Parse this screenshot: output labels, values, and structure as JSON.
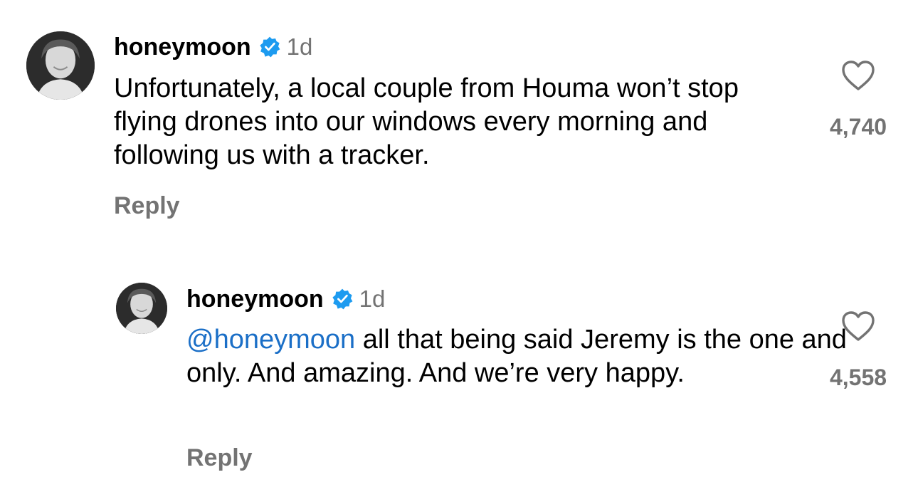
{
  "comments": [
    {
      "username": "honeymoon",
      "verified": true,
      "time": "1d",
      "text_mention": "",
      "text": "Unfortunately, a local couple from Houma won’t stop flying drones into our windows every morning and following us with a tracker.",
      "reply_label": "Reply",
      "like_count": "4,740",
      "avatar_icon": "profile-photo"
    },
    {
      "username": "honeymoon",
      "verified": true,
      "time": "1d",
      "text_mention": "@honeymoon",
      "text": "all that being said Jeremy is the one and only. And amazing. And we’re very happy.",
      "reply_label": "Reply",
      "like_count": "4,558",
      "avatar_icon": "profile-photo"
    }
  ],
  "colors": {
    "verified_badge": "#1d9bf0",
    "mention": "#1b6fc7",
    "secondary_text": "#737373",
    "heart_outline": "#737373"
  },
  "icons": {
    "verified": "verified-badge-icon",
    "like": "heart-outline-icon"
  }
}
